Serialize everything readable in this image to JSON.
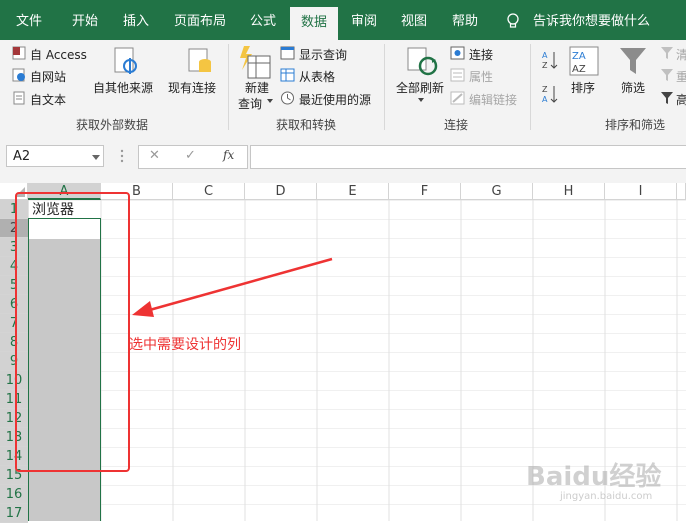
{
  "colors": {
    "excel_green": "#217346",
    "annotation_red": "#ee3333",
    "selection_gray": "#c8c8c8"
  },
  "tabs": [
    {
      "label": "文件",
      "active": false
    },
    {
      "label": "开始",
      "active": false
    },
    {
      "label": "插入",
      "active": false
    },
    {
      "label": "页面布局",
      "active": false
    },
    {
      "label": "公式",
      "active": false
    },
    {
      "label": "数据",
      "active": true
    },
    {
      "label": "审阅",
      "active": false
    },
    {
      "label": "视图",
      "active": false
    },
    {
      "label": "帮助",
      "active": false
    }
  ],
  "tell_me": "告诉我你想要做什么",
  "ribbon": {
    "external": {
      "access": "自 Access",
      "web": "自网站",
      "text": "自文本",
      "other_sources": "自其他来源",
      "existing": "现有连接",
      "group": "获取外部数据"
    },
    "transform": {
      "new_query_line1": "新建",
      "new_query_line2": "查询",
      "show_queries": "显示查询",
      "from_table": "从表格",
      "recent_sources": "最近使用的源",
      "group": "获取和转换"
    },
    "connections": {
      "refresh_all": "全部刷新",
      "connections": "连接",
      "properties": "属性",
      "edit_links": "编辑链接",
      "group": "连接"
    },
    "sort_filter": {
      "sort": "排序",
      "filter": "筛选",
      "clear": "清",
      "reapply": "重",
      "advanced": "高",
      "group": "排序和筛选"
    }
  },
  "formula_bar": {
    "name_box": "A2",
    "cancel": "✕",
    "enter": "✓",
    "fx": "fx",
    "formula": ""
  },
  "columns": [
    "A",
    "B",
    "C",
    "D",
    "E",
    "F",
    "G",
    "H",
    "I"
  ],
  "rows": [
    "1",
    "2",
    "3",
    "4",
    "5",
    "6",
    "7",
    "8",
    "9",
    "10",
    "11",
    "12",
    "13",
    "14",
    "15",
    "16",
    "17"
  ],
  "cells": {
    "A1": "浏览器"
  },
  "annotation": {
    "text": "选中需要设计的列"
  },
  "watermark": {
    "brand": "Baidu经验",
    "url": "jingyan.baidu.com"
  }
}
